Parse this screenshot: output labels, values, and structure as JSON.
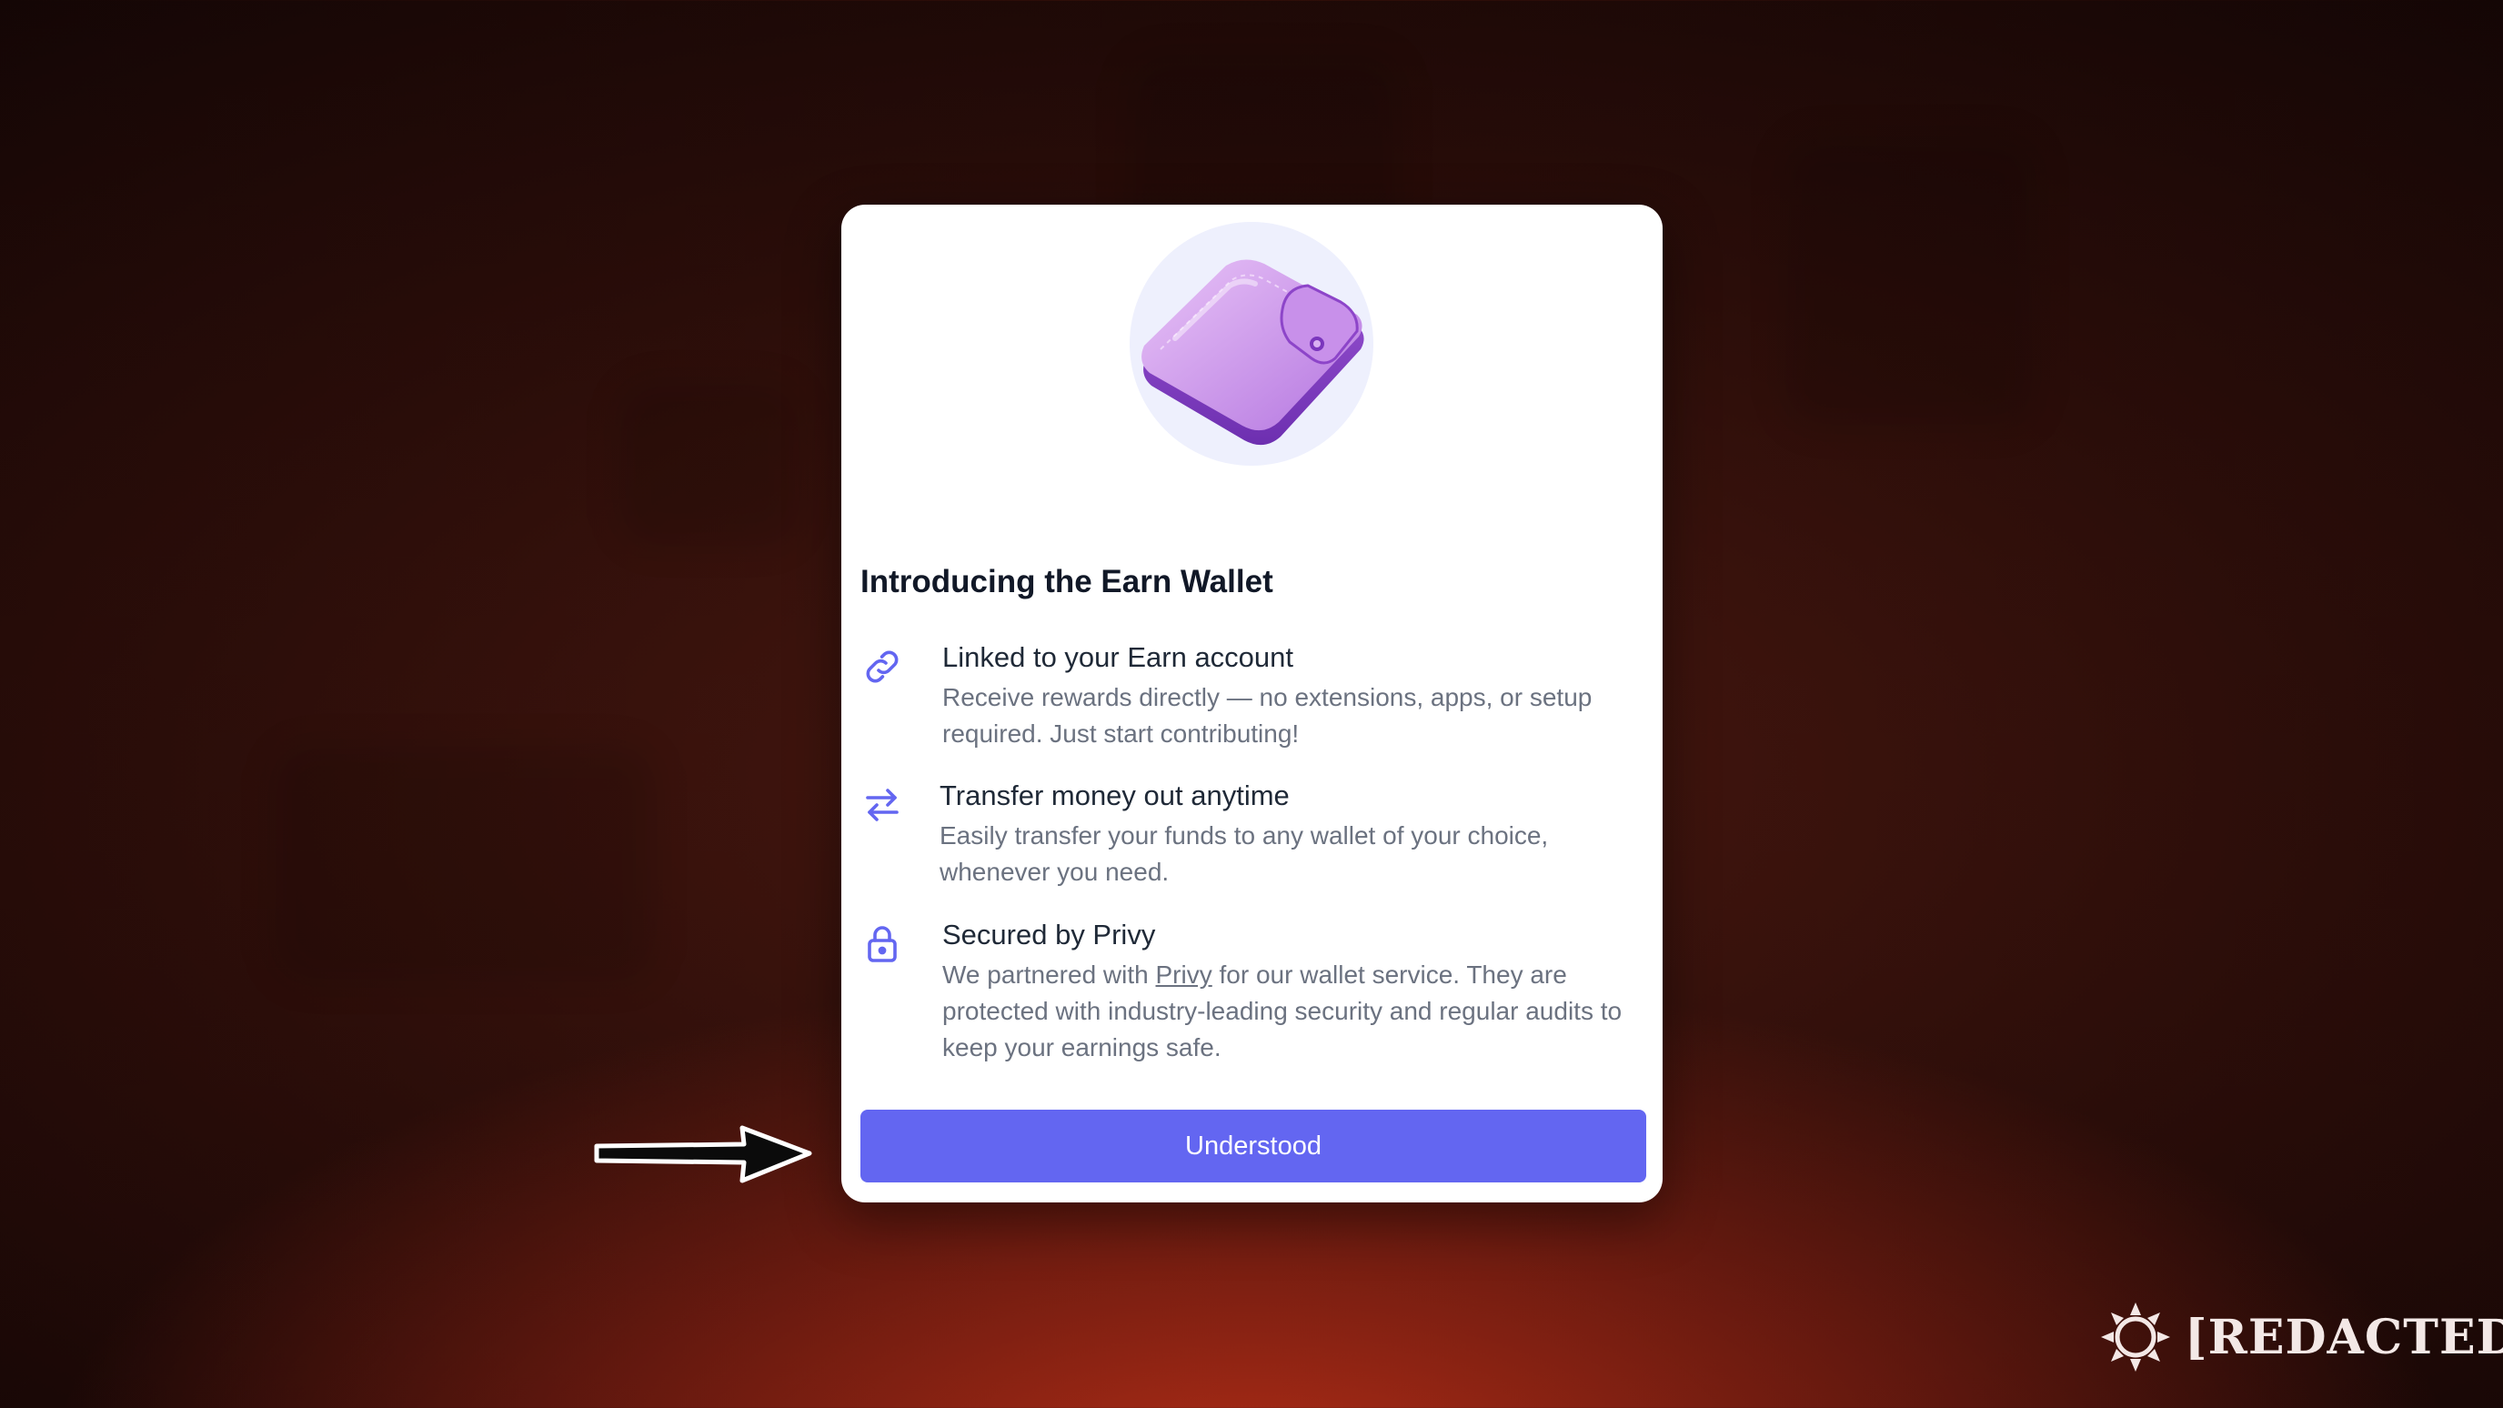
{
  "modal": {
    "title": "Introducing the Earn Wallet",
    "hero_icon": "purple-wallet-icon",
    "features": [
      {
        "icon": "link-icon",
        "heading": "Linked to your Earn account",
        "description": "Receive rewards directly — no extensions, apps, or setup required. Just start contributing!"
      },
      {
        "icon": "transfer-arrows-icon",
        "heading": "Transfer money out anytime",
        "description": "Easily transfer your funds to any wallet of your choice, whenever you need."
      },
      {
        "icon": "lock-icon",
        "heading": "Secured by Privy",
        "description_before": "We partnered with ",
        "description_link": "Privy",
        "description_after": " for our wallet service. They are protected with industry-leading security and regular audits to keep your earnings safe."
      }
    ],
    "button_label": "Understood"
  },
  "overlay": {
    "pointer": "arrow-pointer-icon"
  },
  "watermark": {
    "text": "[REDACTED]",
    "logo": "starburst-logo-icon"
  },
  "colors": {
    "accent": "#6366f1",
    "icon_color": "#6366f1",
    "hero_circle": "#eef0fd",
    "wallet_purple": "#b57be0",
    "background_dark": "#1a0807",
    "background_glow": "#b83a1f"
  }
}
